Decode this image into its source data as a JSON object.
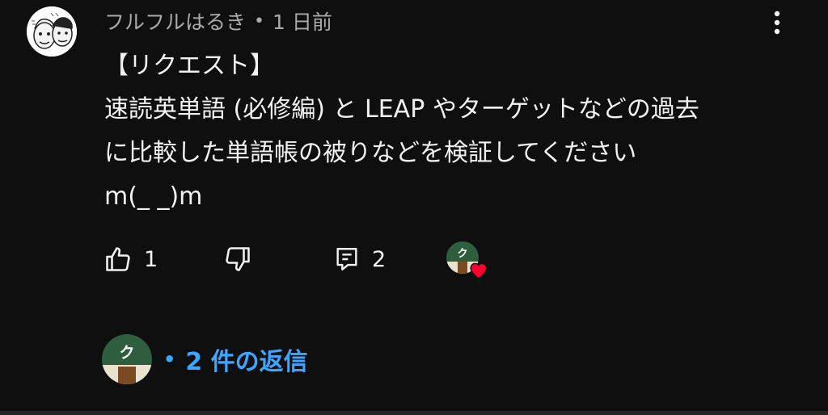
{
  "comment": {
    "author": "フルフルはるき",
    "separator": "•",
    "timestamp": "1 日前",
    "body_lines": [
      "【リクエスト】",
      "速読英単語 (必修編) と LEAP やターゲットなどの過去",
      "に比較した単語帳の被りなどを検証してください",
      "m(_ _)m"
    ],
    "like_count": "1",
    "reply_count": "2",
    "replies_label": "2 件の返信",
    "replies_bullet": "•",
    "creator_avatar_glyph": "ク",
    "icons": {
      "more": "more-vert-icon",
      "like": "thumb-up-icon",
      "dislike": "thumb-down-icon",
      "reply": "comment-icon",
      "heart": "heart-icon"
    },
    "colors": {
      "background": "#0f0f0f",
      "text": "#f1f1f1",
      "meta": "#aaaaaa",
      "link": "#3ea6ff",
      "heart": "#ff0033",
      "creator_avatar_green": "#2e5e3e"
    }
  }
}
